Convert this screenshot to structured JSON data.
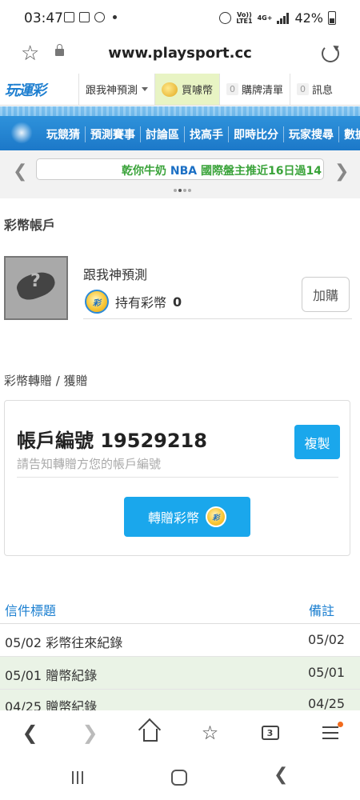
{
  "status_bar": {
    "time": "03:47",
    "network": "LTE1",
    "network_top": "Vo))",
    "network_gen": "4G+",
    "battery": "42%"
  },
  "browser": {
    "url": "www.playsport.cc"
  },
  "header": {
    "logo": "玩運彩",
    "predict_menu": "跟我神預測",
    "buy_coins": "買噱幣",
    "cart_count": "0",
    "cart_label": "購牌清單",
    "msg_count": "0",
    "msg_label": "訊息"
  },
  "nav": {
    "items": [
      "玩競猜",
      "預測賽事",
      "討論區",
      "找高手",
      "即時比分",
      "玩家搜尋",
      "數據"
    ]
  },
  "ticker": {
    "text_prefix": "乾你牛奶",
    "text_highlight": "NBA",
    "text_suffix": "國際盤主推近16日過14"
  },
  "account": {
    "section_title": "彩幣帳戶",
    "name": "跟我神預測",
    "hold_label": "持有彩幣",
    "hold_value": "0",
    "add_button": "加購",
    "coin_badge": "彩"
  },
  "transfer": {
    "section_title": "彩幣轉贈 / 獲贈",
    "account_id_label": "帳戶編號 19529218",
    "hint": "請告知轉贈方您的帳戶編號",
    "copy_button": "複製",
    "transfer_button": "轉贈彩幣"
  },
  "messages": {
    "col_title": "信件標題",
    "col_note": "備註",
    "rows": [
      {
        "title": "05/02 彩幣往來紀錄",
        "note": "05/02"
      },
      {
        "title": "05/01 贈幣紀錄",
        "note": "05/01"
      },
      {
        "title": "04/25 贈幣紀錄",
        "note": "04/25"
      }
    ]
  },
  "bottom_bar": {
    "tab_count": "3"
  }
}
